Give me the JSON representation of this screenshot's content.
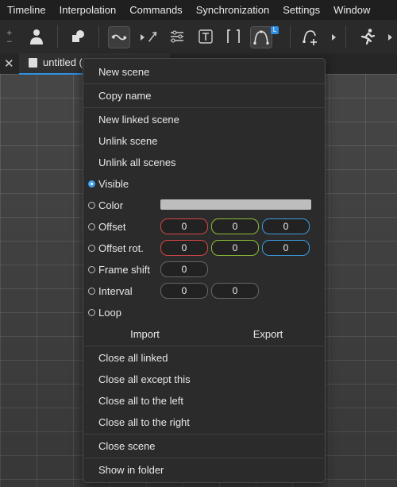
{
  "menubar": [
    "Timeline",
    "Interpolation",
    "Commands",
    "Synchronization",
    "Settings",
    "Window"
  ],
  "toolbar": {
    "icons": [
      "plus-minus-icon",
      "person-icon",
      "blob-icon",
      "curve-line-icon",
      "arrow-icon",
      "curve-edit-icon",
      "text-tool-icon",
      "brackets-icon",
      "bezier-icon",
      "node-add-icon",
      "runner-icon"
    ]
  },
  "tab": {
    "title": "untitled (",
    "close": "✕"
  },
  "context_menu": {
    "new_scene": "New scene",
    "copy_name": "Copy name",
    "new_linked_scene": "New linked scene",
    "unlink_scene": "Unlink scene",
    "unlink_all_scenes": "Unlink all scenes",
    "visible": "Visible",
    "color": "Color",
    "offset": "Offset",
    "offset_values": [
      "0",
      "0",
      "0"
    ],
    "offset_rot": "Offset rot.",
    "offset_rot_values": [
      "0",
      "0",
      "0"
    ],
    "frame_shift": "Frame shift",
    "frame_shift_value": "0",
    "interval": "Interval",
    "interval_values": [
      "0",
      "0"
    ],
    "loop": "Loop",
    "import": "Import",
    "export": "Export",
    "close_all_linked": "Close all linked",
    "close_all_except_this": "Close all except this",
    "close_all_left": "Close all to the left",
    "close_all_right": "Close all to the right",
    "close_scene": "Close scene",
    "show_in_folder": "Show in folder"
  },
  "colors": {
    "accent": "#3a9bef",
    "x_axis": "#d34848",
    "y_axis": "#8dbd3b",
    "z_axis": "#3a9be0",
    "color_swatch": "#bdbdbd"
  }
}
